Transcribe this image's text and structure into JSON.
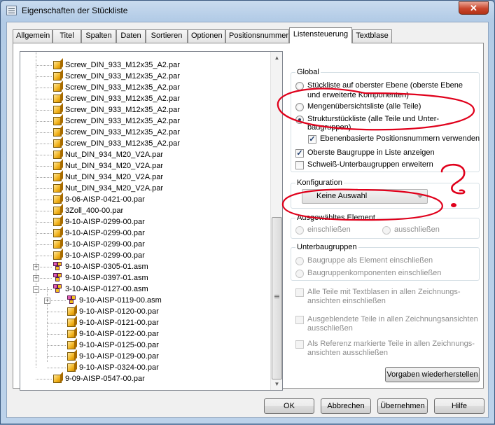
{
  "window": {
    "title": "Eigenschaften der Stückliste",
    "close_glyph": "✕"
  },
  "tabs": [
    "Allgemein",
    "Titel",
    "Spalten",
    "Daten",
    "Sortieren",
    "Optionen",
    "Positionsnummer",
    "Listensteuerung",
    "Textblase"
  ],
  "active_tab": "Listensteuerung",
  "tree": {
    "rows": [
      {
        "label": "Screw_DIN_933_M12x35_A2.par",
        "icon": "part-icon"
      },
      {
        "label": "Screw_DIN_933_M12x35_A2.par",
        "icon": "part-icon"
      },
      {
        "label": "Screw_DIN_933_M12x35_A2.par",
        "icon": "part-icon"
      },
      {
        "label": "Screw_DIN_933_M12x35_A2.par",
        "icon": "part-icon"
      },
      {
        "label": "Screw_DIN_933_M12x35_A2.par",
        "icon": "part-icon"
      },
      {
        "label": "Screw_DIN_933_M12x35_A2.par",
        "icon": "part-icon"
      },
      {
        "label": "Screw_DIN_933_M12x35_A2.par",
        "icon": "part-icon"
      },
      {
        "label": "Screw_DIN_933_M12x35_A2.par",
        "icon": "part-icon"
      },
      {
        "label": "Nut_DIN_934_M20_V2A.par",
        "icon": "part-icon"
      },
      {
        "label": "Nut_DIN_934_M20_V2A.par",
        "icon": "part-icon"
      },
      {
        "label": "Nut_DIN_934_M20_V2A.par",
        "icon": "part-icon"
      },
      {
        "label": "Nut_DIN_934_M20_V2A.par",
        "icon": "part-icon"
      },
      {
        "label": "9-06-AISP-0421-00.par",
        "icon": "part-icon"
      },
      {
        "label": "3Zoll_400-00.par",
        "icon": "part-icon"
      },
      {
        "label": "9-10-AISP-0299-00.par",
        "icon": "part-icon"
      },
      {
        "label": "9-10-AISP-0299-00.par",
        "icon": "part-icon"
      },
      {
        "label": "9-10-AISP-0299-00.par",
        "icon": "part-icon"
      },
      {
        "label": "9-10-AISP-0299-00.par",
        "icon": "part-icon"
      },
      {
        "label": "9-10-AISP-0305-01.asm",
        "icon": "assembly-icon",
        "expander": "+"
      },
      {
        "label": "9-10-AISP-0397-01.asm",
        "icon": "assembly-icon",
        "expander": "+"
      },
      {
        "label": "3-10-AISP-0127-00.asm",
        "icon": "assembly-icon",
        "expander": "−"
      },
      {
        "label": "9-10-AISP-0119-00.asm",
        "icon": "assembly-icon",
        "expander": "+",
        "indent": 1
      },
      {
        "label": "9-10-AISP-0120-00.par",
        "icon": "part-icon",
        "indent": 1
      },
      {
        "label": "9-10-AISP-0121-00.par",
        "icon": "part-icon",
        "indent": 1
      },
      {
        "label": "9-10-AISP-0122-00.par",
        "icon": "part-icon",
        "indent": 1
      },
      {
        "label": "9-10-AISP-0125-00.par",
        "icon": "part-icon",
        "indent": 1
      },
      {
        "label": "9-10-AISP-0129-00.par",
        "icon": "part-icon",
        "indent": 1
      },
      {
        "label": "9-10-AISP-0324-00.par",
        "icon": "part-icon",
        "indent": 1
      },
      {
        "label": "9-09-AISP-0547-00.par",
        "icon": "part-icon"
      }
    ]
  },
  "global": {
    "title": "Global",
    "opt_top_level": "Stückliste auf oberster Ebene (oberste Ebene und erweiterte Komponenten)",
    "opt_top_level_l1": "Stückliste auf oberster Ebene (oberste Ebene",
    "opt_top_level_l2": "und erweiterte Komponenten)",
    "opt_quantity": "Mengenübersichtsliste (alle Teile)",
    "opt_structure_l1": "Strukturstückliste (alle Teile und Unter-",
    "opt_structure_l2": "baugruppen)",
    "chk_level_based": "Ebenenbasierte Positionsnummern verwenden",
    "chk_top_assembly": "Oberste Baugruppe in Liste anzeigen",
    "chk_weldment": "Schweiß-Unterbaugruppen erweitern",
    "selected": "structure",
    "checked": [
      "level_based",
      "top_assembly"
    ]
  },
  "configuration": {
    "title": "Konfiguration",
    "selected_value": "Keine Auswahl"
  },
  "selected_element": {
    "title": "Ausgewähltes Element",
    "include": "einschließen",
    "exclude": "ausschließen"
  },
  "subassemblies": {
    "title": "Unterbaugruppen",
    "opt_as_element": "Baugruppe als Element einschließen",
    "opt_components": "Baugruppenkomponenten einschließen"
  },
  "exclusions": {
    "chk_textblase_l1": "Alle Teile mit Textblasen in allen Zeichnungs-",
    "chk_textblase_l2": "ansichten einschließen",
    "chk_hidden_l1": "Ausgeblendete Teile in allen Zeichnungsansichten",
    "chk_hidden_l2": "ausschließen",
    "chk_reference_l1": "Als Referenz markierte Teile in allen Zeichnungs-",
    "chk_reference_l2": "ansichten ausschließen"
  },
  "restore_button": "Vorgaben wiederherstellen",
  "buttons": {
    "ok": "OK",
    "cancel": "Abbrechen",
    "apply": "Übernehmen",
    "help": "Hilfe"
  },
  "annotation": {
    "color": "#e0001b",
    "question_mark": "?"
  },
  "colors": {
    "title_bar": "#b2cbe6",
    "close_button": "#c9462c",
    "dialog_bg": "#f0f0f0"
  }
}
